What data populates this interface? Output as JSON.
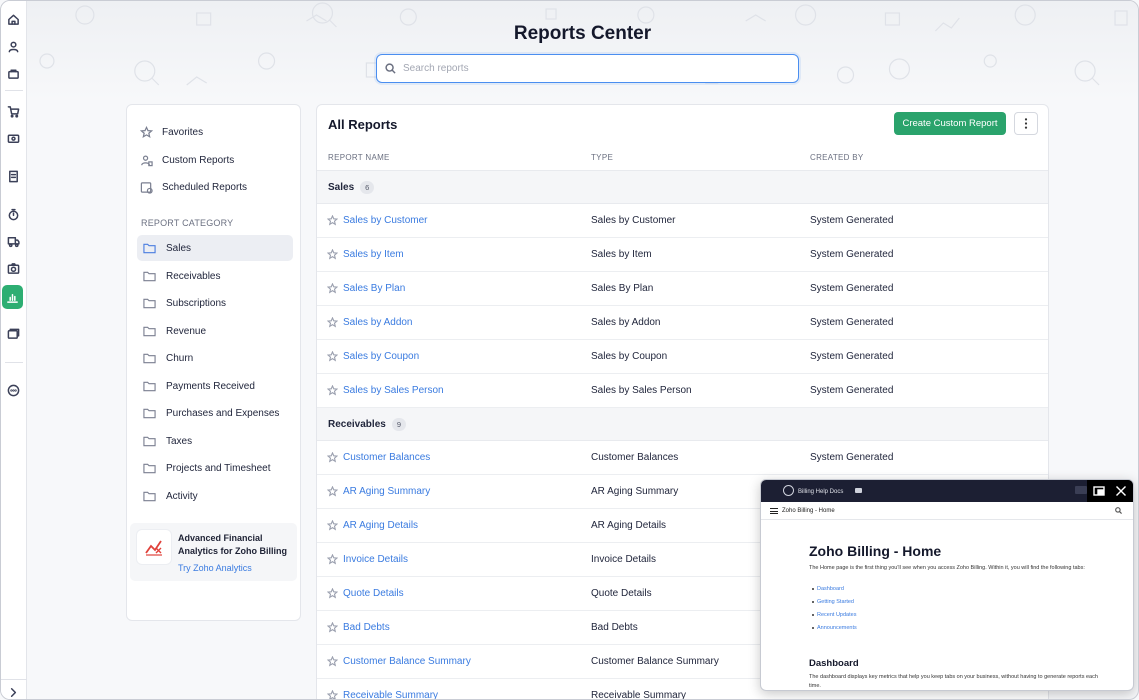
{
  "rail": {
    "items": [
      "home-icon",
      "user-icon",
      "bag-icon",
      "cart-icon",
      "money-icon",
      "receipt-icon",
      "timer-icon",
      "truck-icon",
      "camera-icon",
      "chart-icon",
      "cards-icon",
      "more-icon",
      "expand-icon"
    ],
    "active": "chart-icon",
    "accent": "#2dae72"
  },
  "page": {
    "title": "Reports Center",
    "search_placeholder": "Search reports"
  },
  "sidebar": {
    "quick": [
      {
        "label": "Favorites",
        "icon": "star-icon"
      },
      {
        "label": "Custom Reports",
        "icon": "user-report-icon"
      },
      {
        "label": "Scheduled Reports",
        "icon": "schedule-icon"
      }
    ],
    "category_heading": "REPORT CATEGORY",
    "categories": [
      {
        "label": "Sales",
        "selected": true
      },
      {
        "label": "Receivables"
      },
      {
        "label": "Subscriptions"
      },
      {
        "label": "Revenue"
      },
      {
        "label": "Churn"
      },
      {
        "label": "Payments Received"
      },
      {
        "label": "Purchases and Expenses"
      },
      {
        "label": "Taxes"
      },
      {
        "label": "Projects and Timesheet"
      },
      {
        "label": "Activity"
      }
    ],
    "promo": {
      "title": "Advanced Financial Analytics for Zoho Billing",
      "link": "Try Zoho Analytics"
    }
  },
  "main": {
    "heading": "All Reports",
    "create_label": "Create Custom Report",
    "create_color": "#2aa36c",
    "columns": {
      "name": "REPORT NAME",
      "type": "TYPE",
      "created_by": "CREATED BY"
    },
    "groups": [
      {
        "name": "Sales",
        "count": "6",
        "rows": [
          {
            "name": "Sales by Customer",
            "type": "Sales by Customer",
            "created_by": "System Generated"
          },
          {
            "name": "Sales by Item",
            "type": "Sales by Item",
            "created_by": "System Generated"
          },
          {
            "name": "Sales By Plan",
            "type": "Sales By Plan",
            "created_by": "System Generated"
          },
          {
            "name": "Sales by Addon",
            "type": "Sales by Addon",
            "created_by": "System Generated"
          },
          {
            "name": "Sales by Coupon",
            "type": "Sales by Coupon",
            "created_by": "System Generated"
          },
          {
            "name": "Sales by Sales Person",
            "type": "Sales by Sales Person",
            "created_by": "System Generated"
          }
        ]
      },
      {
        "name": "Receivables",
        "count": "9",
        "rows": [
          {
            "name": "Customer Balances",
            "type": "Customer Balances",
            "created_by": "System Generated"
          },
          {
            "name": "AR Aging Summary",
            "type": "AR Aging Summary",
            "created_by": ""
          },
          {
            "name": "AR Aging Details",
            "type": "AR Aging Details",
            "created_by": ""
          },
          {
            "name": "Invoice Details",
            "type": "Invoice Details",
            "created_by": ""
          },
          {
            "name": "Quote Details",
            "type": "Quote Details",
            "created_by": ""
          },
          {
            "name": "Bad Debts",
            "type": "Bad Debts",
            "created_by": ""
          },
          {
            "name": "Customer Balance Summary",
            "type": "Customer Balance Summary",
            "created_by": ""
          },
          {
            "name": "Receivable Summary",
            "type": "Receivable Summary",
            "created_by": ""
          }
        ]
      }
    ]
  },
  "help": {
    "brand_small": "Zoho",
    "brand": "Billing Help Docs",
    "nav_title": "Zoho Billing - Home",
    "heading": "Zoho Billing - Home",
    "intro": "The Home page is the first thing you'll see when you access Zoho Billing. Within it, you will find the following tabs:",
    "links": [
      "Dashboard",
      "Getting Started",
      "Recent Updates",
      "Announcements"
    ],
    "section": "Dashboard",
    "section_text": "The dashboard displays key metrics that help you keep tabs on your business, without having to generate reports each time."
  }
}
